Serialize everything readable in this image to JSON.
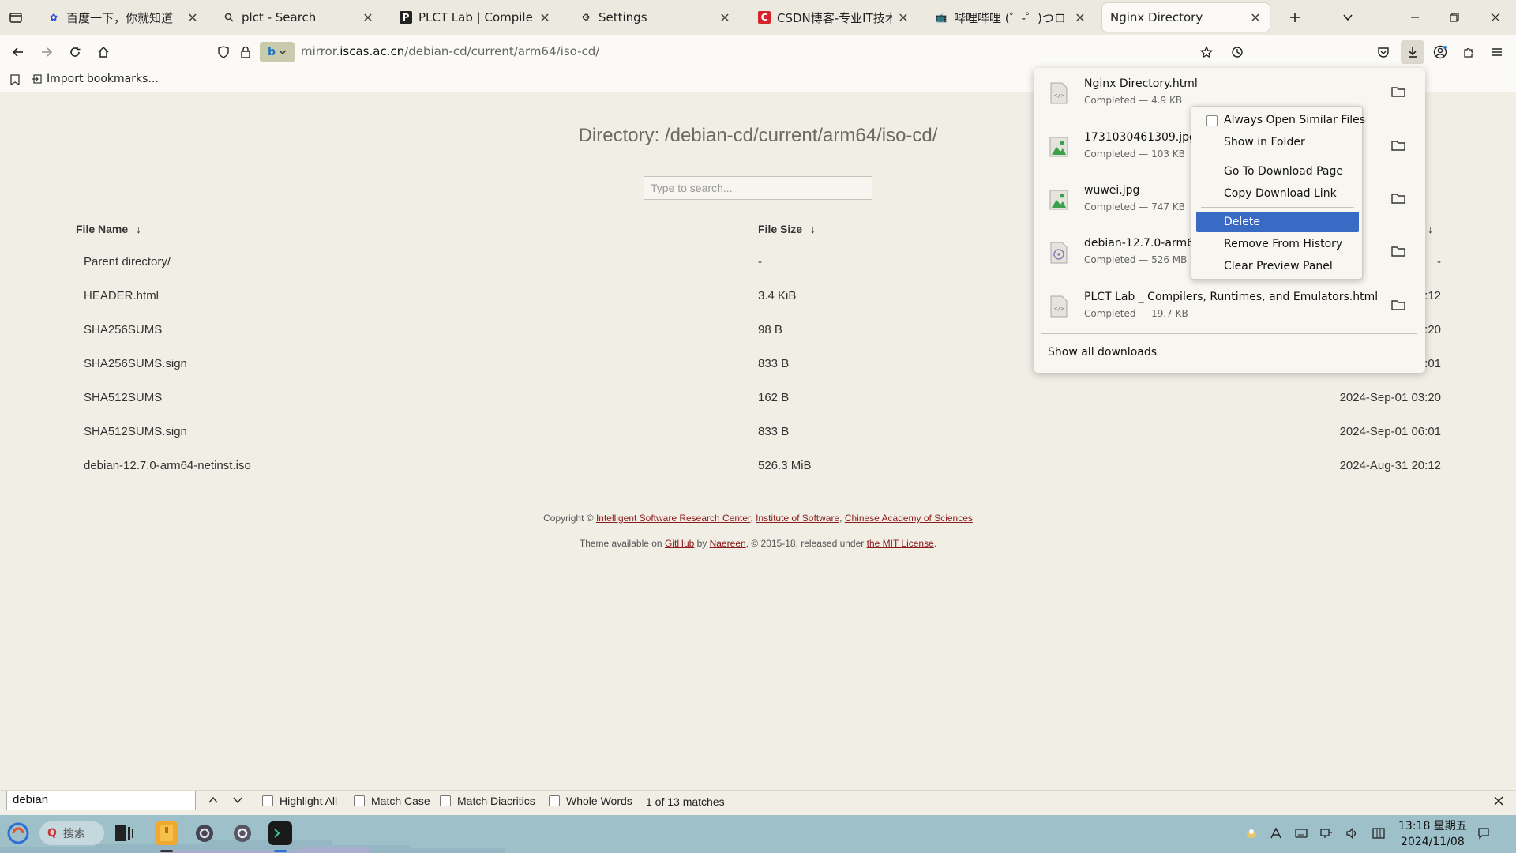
{
  "browser": {
    "tabs": [
      {
        "title": "百度一下，你就知道",
        "favicon": "baidu-paw-icon",
        "active": false
      },
      {
        "title": "plct - Search",
        "favicon": "search-icon",
        "active": false
      },
      {
        "title": "PLCT Lab | Compilers, Runtim",
        "favicon": "plct-p-icon",
        "active": false
      },
      {
        "title": "Settings",
        "favicon": "gear-icon",
        "active": false
      },
      {
        "title": "CSDN博客-专业IT技术发表平",
        "favicon": "csdn-c-icon",
        "active": false
      },
      {
        "title": "哔哩哔哩 (゜-゜)つロ 干杯~-b",
        "favicon": "bilibili-tv-icon",
        "active": false
      },
      {
        "title": "Nginx Directory",
        "favicon": "",
        "active": true
      }
    ],
    "url_prefix": "mirror.",
    "url_domain": "iscas.ac.cn",
    "url_path": "/debian-cd/current/arm64/iso-cd/",
    "bookmark_import": "Import bookmarks..."
  },
  "page": {
    "title": "Directory: /debian-cd/current/arm64/iso-cd/",
    "search_placeholder": "Type to search...",
    "columns": {
      "name": "File Name",
      "size": "File Size",
      "sort_arrow": "↓"
    },
    "rows": [
      {
        "name": "Parent directory/",
        "size": "-",
        "date": "-"
      },
      {
        "name": "HEADER.html",
        "size": "3.4 KiB",
        "date": "2024-Aug-31 20:12"
      },
      {
        "name": "SHA256SUMS",
        "size": "98 B",
        "date": "2024-Sep-01 03:20"
      },
      {
        "name": "SHA256SUMS.sign",
        "size": "833 B",
        "date": "2024-Sep-01 06:01"
      },
      {
        "name": "SHA512SUMS",
        "size": "162 B",
        "date": "2024-Sep-01 03:20"
      },
      {
        "name": "SHA512SUMS.sign",
        "size": "833 B",
        "date": "2024-Sep-01 06:01"
      },
      {
        "name": "debian-12.7.0-arm64-netinst.iso",
        "size": "526.3 MiB",
        "date": "2024-Aug-31 20:12"
      }
    ],
    "footer": {
      "copyright_prefix": "Copyright © ",
      "link1": "Intelligent Software Research Center",
      "sep1": ", ",
      "link2": "Institute of Software",
      "sep2": ", ",
      "link3": "Chinese Academy of Sciences",
      "theme_prefix": "Theme available on ",
      "github": "GitHub",
      "by": " by ",
      "author": "Naereen",
      "years": ", © 2015-18, released under ",
      "license": "the MIT License",
      "end": "."
    }
  },
  "downloads": {
    "items": [
      {
        "name": "Nginx Directory.html",
        "status": "Completed — 4.9 KB",
        "icon": "html-file-icon"
      },
      {
        "name": "1731030461309.jpg",
        "status": "Completed — 103 KB",
        "icon": "image-file-icon"
      },
      {
        "name": "wuwei.jpg",
        "status": "Completed — 747 KB",
        "icon": "image-file-icon"
      },
      {
        "name": "debian-12.7.0-arm64-ne",
        "status": "Completed — 526 MB",
        "icon": "iso-file-icon"
      },
      {
        "name": "PLCT Lab _ Compilers, Runtimes, and Emulators.html",
        "status": "Completed — 19.7 KB",
        "icon": "html-file-icon"
      }
    ],
    "show_all": "Show all downloads"
  },
  "context_menu": {
    "items": [
      {
        "label": "Always Open Similar Files",
        "checkbox": true
      },
      {
        "label": "Show in Folder"
      },
      {
        "label": "Go To Download Page"
      },
      {
        "label": "Copy Download Link"
      },
      {
        "label": "Delete",
        "highlighted": true
      },
      {
        "label": "Remove From History"
      },
      {
        "label": "Clear Preview Panel"
      }
    ]
  },
  "findbar": {
    "query": "debian",
    "highlight_all": "Highlight All",
    "match_case": "Match Case",
    "match_diacritics": "Match Diacritics",
    "whole_words": "Whole Words",
    "status": "1 of 13 matches"
  },
  "taskbar": {
    "search_label": "搜索",
    "time": "13:18 星期五",
    "date": "2024/11/08"
  },
  "colors": {
    "page_bg": "#f1eee6",
    "link": "#8b1a1a",
    "menu_highlight": "#3a6bc4",
    "taskbar": "#9ec0c8"
  }
}
